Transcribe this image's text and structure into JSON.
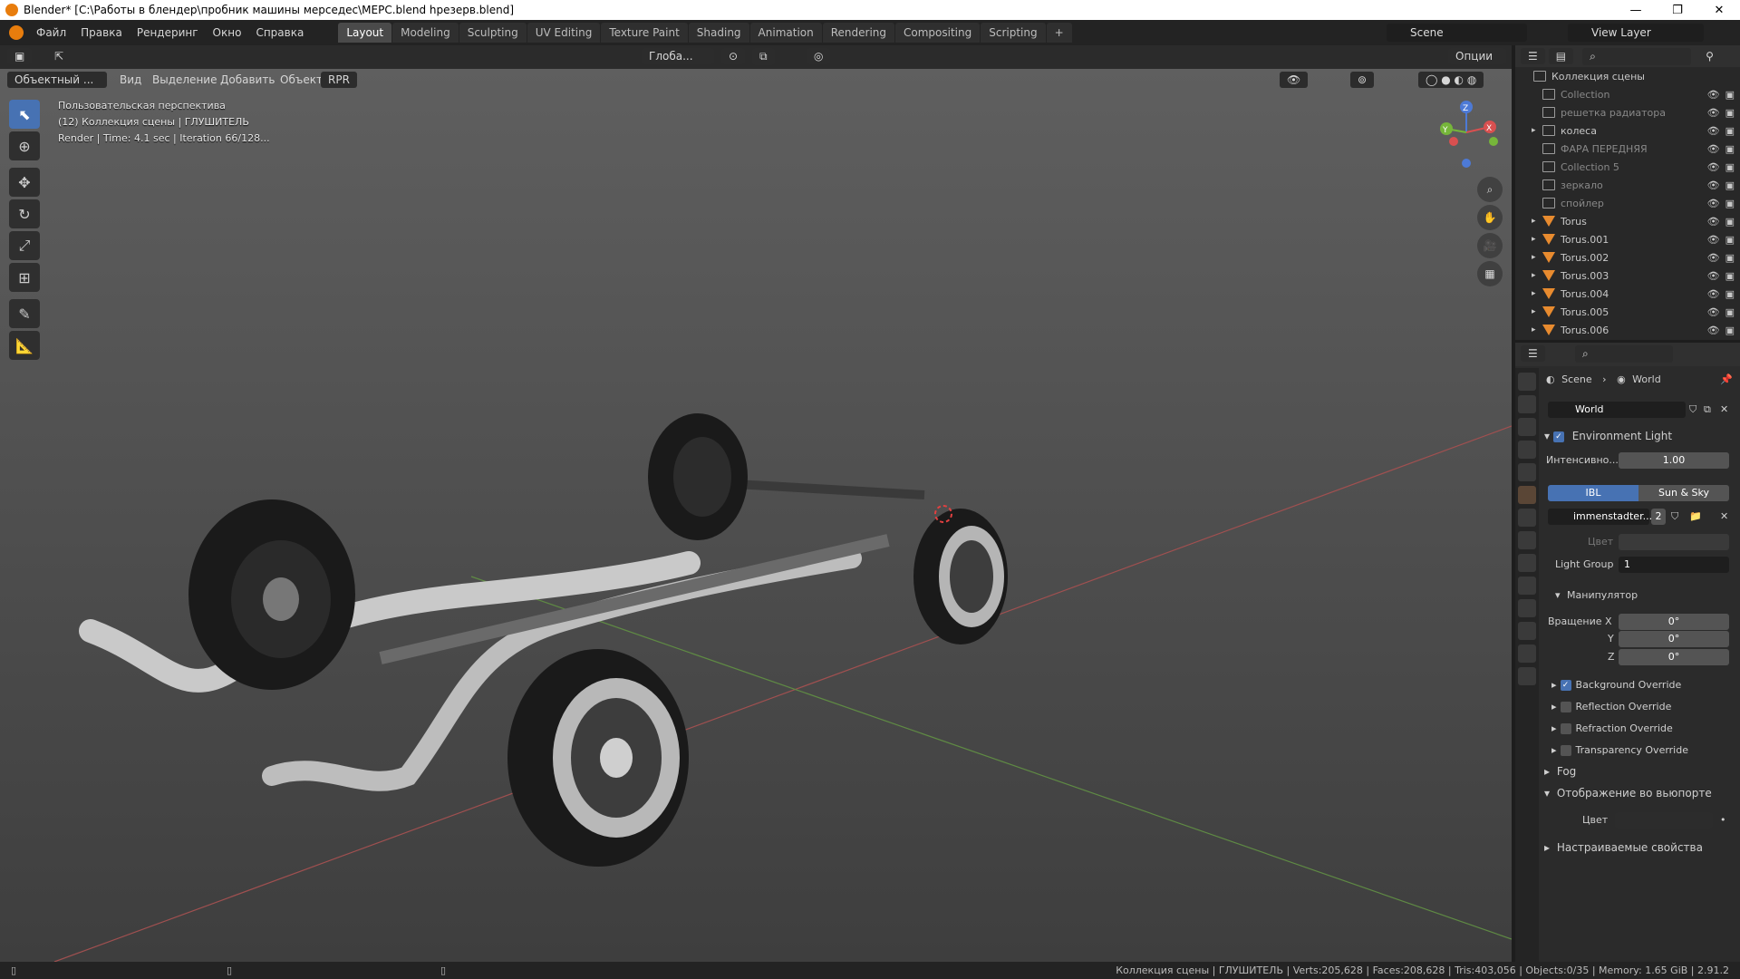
{
  "window": {
    "title": "Blender* [C:\\Работы в блендер\\пробник машины мерседес\\МЕРС.blend hрезерв.blend]",
    "controls": [
      "—",
      "❐",
      "✕"
    ]
  },
  "menu": [
    "Файл",
    "Правка",
    "Рендеринг",
    "Окно",
    "Справка"
  ],
  "workspaces": [
    "Layout",
    "Modeling",
    "Sculpting",
    "UV Editing",
    "Texture Paint",
    "Shading",
    "Animation",
    "Rendering",
    "Compositing",
    "Scripting"
  ],
  "active_workspace": "Layout",
  "scene_selector": "Scene",
  "view_layer_selector": "View Layer",
  "toolbar_header": {
    "transform_orientation": "Глоба...",
    "options_label": "Опции"
  },
  "viewport_header": {
    "mode": "Объектный ...",
    "menus": [
      "Вид",
      "Выделение",
      "Добавить",
      "Объект"
    ],
    "engine": "RPR"
  },
  "viewport_info": {
    "line1": "Пользовательская перспектива",
    "line2": "(12) Коллекция сцены | ГЛУШИТЕЛЬ",
    "line3": "Render | Time: 4.1 sec | Iteration 66/128..."
  },
  "gizmo_axes": {
    "z": "Z",
    "x": "X",
    "y": "Y"
  },
  "outliner": {
    "title": "Коллекция сцены",
    "items": [
      {
        "label": "Collection",
        "type": "collection",
        "dim": true
      },
      {
        "label": "решетка радиатора",
        "type": "collection",
        "dim": true
      },
      {
        "label": "колеса",
        "type": "collection",
        "dim": false,
        "expandable": true
      },
      {
        "label": "ФАРА ПЕРЕДНЯЯ",
        "type": "collection",
        "dim": true
      },
      {
        "label": "Collection 5",
        "type": "collection",
        "dim": true
      },
      {
        "label": "зеркало",
        "type": "collection",
        "dim": true
      },
      {
        "label": "спойлер",
        "type": "collection",
        "dim": true
      },
      {
        "label": "Torus",
        "type": "object",
        "dim": false,
        "expandable": true
      },
      {
        "label": "Torus.001",
        "type": "object",
        "dim": false,
        "expandable": true
      },
      {
        "label": "Torus.002",
        "type": "object",
        "dim": false,
        "expandable": true
      },
      {
        "label": "Torus.003",
        "type": "object",
        "dim": false,
        "expandable": true
      },
      {
        "label": "Torus.004",
        "type": "object",
        "dim": false,
        "expandable": true
      },
      {
        "label": "Torus.005",
        "type": "object",
        "dim": false,
        "expandable": true
      },
      {
        "label": "Torus.006",
        "type": "object",
        "dim": false,
        "expandable": true
      }
    ]
  },
  "properties": {
    "breadcrumb_scene": "Scene",
    "breadcrumb_world": "World",
    "world_name": "World",
    "environment_light_label": "Environment Light",
    "environment_light_checked": true,
    "intensity_label": "Интенсивно...",
    "intensity_value": "1.00",
    "mode_tabs": [
      "IBL",
      "Sun & Sky"
    ],
    "active_mode": "IBL",
    "image_name": "immenstadter...",
    "image_users": "2",
    "color_label": "Цвет",
    "light_group_label": "Light Group",
    "light_group_value": "1",
    "manipulator_label": "Манипулятор",
    "rotation_x_label": "Вращение X",
    "rotation_y_label": "Y",
    "rotation_z_label": "Z",
    "rotation_x": "0°",
    "rotation_y": "0°",
    "rotation_z": "0°",
    "overrides": [
      {
        "label": "Background Override",
        "checked": true
      },
      {
        "label": "Reflection Override",
        "checked": false
      },
      {
        "label": "Refraction Override",
        "checked": false
      },
      {
        "label": "Transparency Override",
        "checked": false
      }
    ],
    "fog_label": "Fog",
    "viewport_display_label": "Отображение во вьюпорте",
    "viewport_color_label": "Цвет",
    "custom_props_label": "Настраиваемые свойства"
  },
  "statusbar": {
    "text": "Коллекция сцены | ГЛУШИТЕЛЬ | Verts:205,628 | Faces:208,628 | Tris:403,056 | Objects:0/35 | Memory: 1.65 GiB | 2.91.2"
  },
  "colors": {
    "accent": "#4772b3",
    "object_icon": "#e88b2f",
    "active_tab": "#4a4a4a"
  }
}
